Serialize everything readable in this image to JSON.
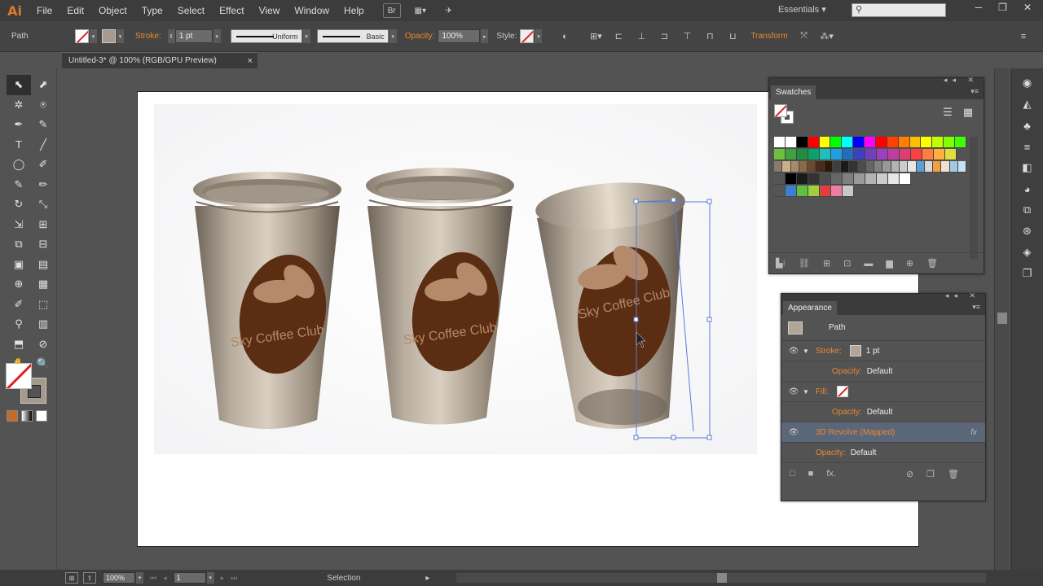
{
  "app": {
    "logo": "Ai"
  },
  "menu": [
    "File",
    "Edit",
    "Object",
    "Type",
    "Select",
    "Effect",
    "View",
    "Window",
    "Help"
  ],
  "menu_icons": {
    "bridge": "Br",
    "arrange": "▦▾",
    "send": "✈"
  },
  "workspace": {
    "label": "Essentials ▾"
  },
  "search": {
    "placeholder": ""
  },
  "window_controls": {
    "minimize": "─",
    "restore": "❐",
    "close": "✕"
  },
  "control": {
    "selection_type": "Path",
    "stroke_label": "Stroke:",
    "stroke_weight": "1 pt",
    "profile": "Uniform",
    "brush": "Basic",
    "opacity_label": "Opacity:",
    "opacity_value": "100%",
    "style_label": "Style:",
    "transform_label": "Transform"
  },
  "document": {
    "tab_title": "Untitled-3* @ 100% (RGB/GPU Preview)",
    "close": "×"
  },
  "tools": [
    "⬉",
    "⬈",
    "✲",
    "⍟",
    "✒",
    "✎",
    "T",
    "╱",
    "◯",
    "✐",
    "✎",
    "✏",
    "↻",
    "⤡",
    "⇲",
    "⊞",
    "⧉",
    "⊟",
    "▣",
    "▤",
    "⊕",
    "▦",
    "✐",
    "⬚",
    "⚲",
    "▥",
    "⬒",
    "⊘",
    "✋",
    "🔍"
  ],
  "artwork": {
    "cups": [
      {
        "label": "Sky Coffee Club"
      },
      {
        "label": "Sky Coffee Club"
      },
      {
        "label": "Sky Coffee Club"
      }
    ],
    "colors": {
      "cup": "#a89c8c",
      "logo": "#5b2d12",
      "bean": "#b48a6a"
    }
  },
  "swatches": {
    "title": "Swatches",
    "view_list": "☰",
    "view_grid": "▦",
    "rows": [
      [
        "#ffffff",
        "#ffffff",
        "#000000",
        "#ff0000",
        "#ffff00",
        "#00ff00",
        "#00ffff",
        "#0000ff",
        "#ff00ff",
        "#ff0000",
        "#ff4000",
        "#ff8000",
        "#ffbf00",
        "#ffff00",
        "#c0ff00",
        "#80ff00",
        "#40ff00"
      ],
      [
        "#6fbf3f",
        "#3fa13f",
        "#1f8f3f",
        "#0f9f6f",
        "#1fbfbf",
        "#1f9fdf",
        "#1f6fbf",
        "#3f3fbf",
        "#6f3fbf",
        "#9f3fbf",
        "#bf3f9f",
        "#df3f6f",
        "#ff3f3f",
        "#ff7f3f",
        "#ffaf3f",
        "#dfdf3f"
      ],
      [
        "#8a7a6a",
        "#c8b08a",
        "#a88a6a",
        "#8a6a4a",
        "#6a4a2a",
        "#4a2a1a",
        "#2a1a0a",
        "#3f3f3f",
        "#1a1a1a",
        "#333333",
        "#4d4d4d",
        "#666666",
        "#808080",
        "#999999",
        "#b3b3b3",
        "#cccccc",
        "#e6e6e6",
        "#5aa0d8",
        "#d8d8d8",
        "#f0a040",
        "#f0e0d0",
        "#a0c8e8",
        "#c8e0f0"
      ],
      [
        "#555555",
        "#000000",
        "#1a1a1a",
        "#333333",
        "#4d4d4d",
        "#666666",
        "#808080",
        "#999999",
        "#b3b3b3",
        "#cccccc",
        "#e6e6e6",
        "#ffffff"
      ],
      [
        "#555555",
        "#3f7fcf",
        "#5fbf3f",
        "#9fcf3f",
        "#df3f3f",
        "#ef7fa0",
        "#c8c8c8"
      ]
    ],
    "footer": [
      "▙⁝",
      "⛓",
      "⊞",
      "⊡",
      "▬",
      "▆",
      "⊕",
      "🗑"
    ]
  },
  "appearance": {
    "title": "Appearance",
    "object": "Path",
    "rows": [
      {
        "eye": "👁",
        "tri": "▼",
        "label": "Stroke:",
        "swatch": "stroke",
        "value": "1 pt"
      },
      {
        "eye": "",
        "tri": "",
        "label": "Opacity:",
        "value": "Default",
        "indent": true
      },
      {
        "eye": "👁",
        "tri": "▼",
        "label": "Fill:",
        "swatch": "none",
        "value": ""
      },
      {
        "eye": "",
        "tri": "",
        "label": "Opacity:",
        "value": "Default",
        "indent": true
      },
      {
        "eye": "👁",
        "tri": "",
        "label": "3D Revolve (Mapped)",
        "value": "",
        "fx": "fx",
        "selected": true
      },
      {
        "eye": "",
        "tri": "",
        "label": "Opacity:",
        "value": "Default"
      }
    ],
    "footer": [
      "□",
      "■",
      "fx.",
      "⊘",
      "❐",
      "🗑"
    ]
  },
  "status": {
    "zoom": "100%",
    "artboard": "1",
    "tool": "Selection"
  }
}
